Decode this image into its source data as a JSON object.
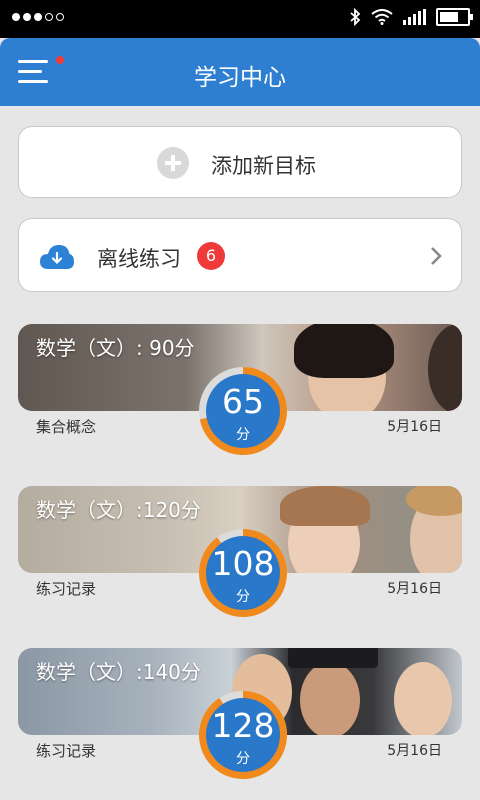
{
  "header": {
    "title": "学习中心"
  },
  "add_goal": {
    "label": "添加新目标"
  },
  "offline": {
    "label": "离线练习",
    "badge": "6"
  },
  "targets": [
    {
      "title": "数学（文）: 90分",
      "score": "65",
      "unit": "分",
      "subtitle": "集合概念",
      "date": "5月16日",
      "progress": 0.72,
      "colors": {
        "accent": "#f08a1c",
        "score_bg": "#2a78c9"
      }
    },
    {
      "title": "数学（文）:120分",
      "score": "108",
      "unit": "分",
      "subtitle": "练习记录",
      "date": "5月16日",
      "progress": 0.9,
      "colors": {
        "accent": "#f08a1c",
        "score_bg": "#2a78c9"
      }
    },
    {
      "title": "数学（文）:140分",
      "score": "128",
      "unit": "分",
      "subtitle": "练习记录",
      "date": "5月16日",
      "progress": 0.91,
      "colors": {
        "accent": "#f08a1c",
        "score_bg": "#2a78c9"
      }
    }
  ],
  "theme": {
    "primary": "#2e7fd1",
    "badge": "#f03a3a",
    "background": "#e6e6e6"
  }
}
